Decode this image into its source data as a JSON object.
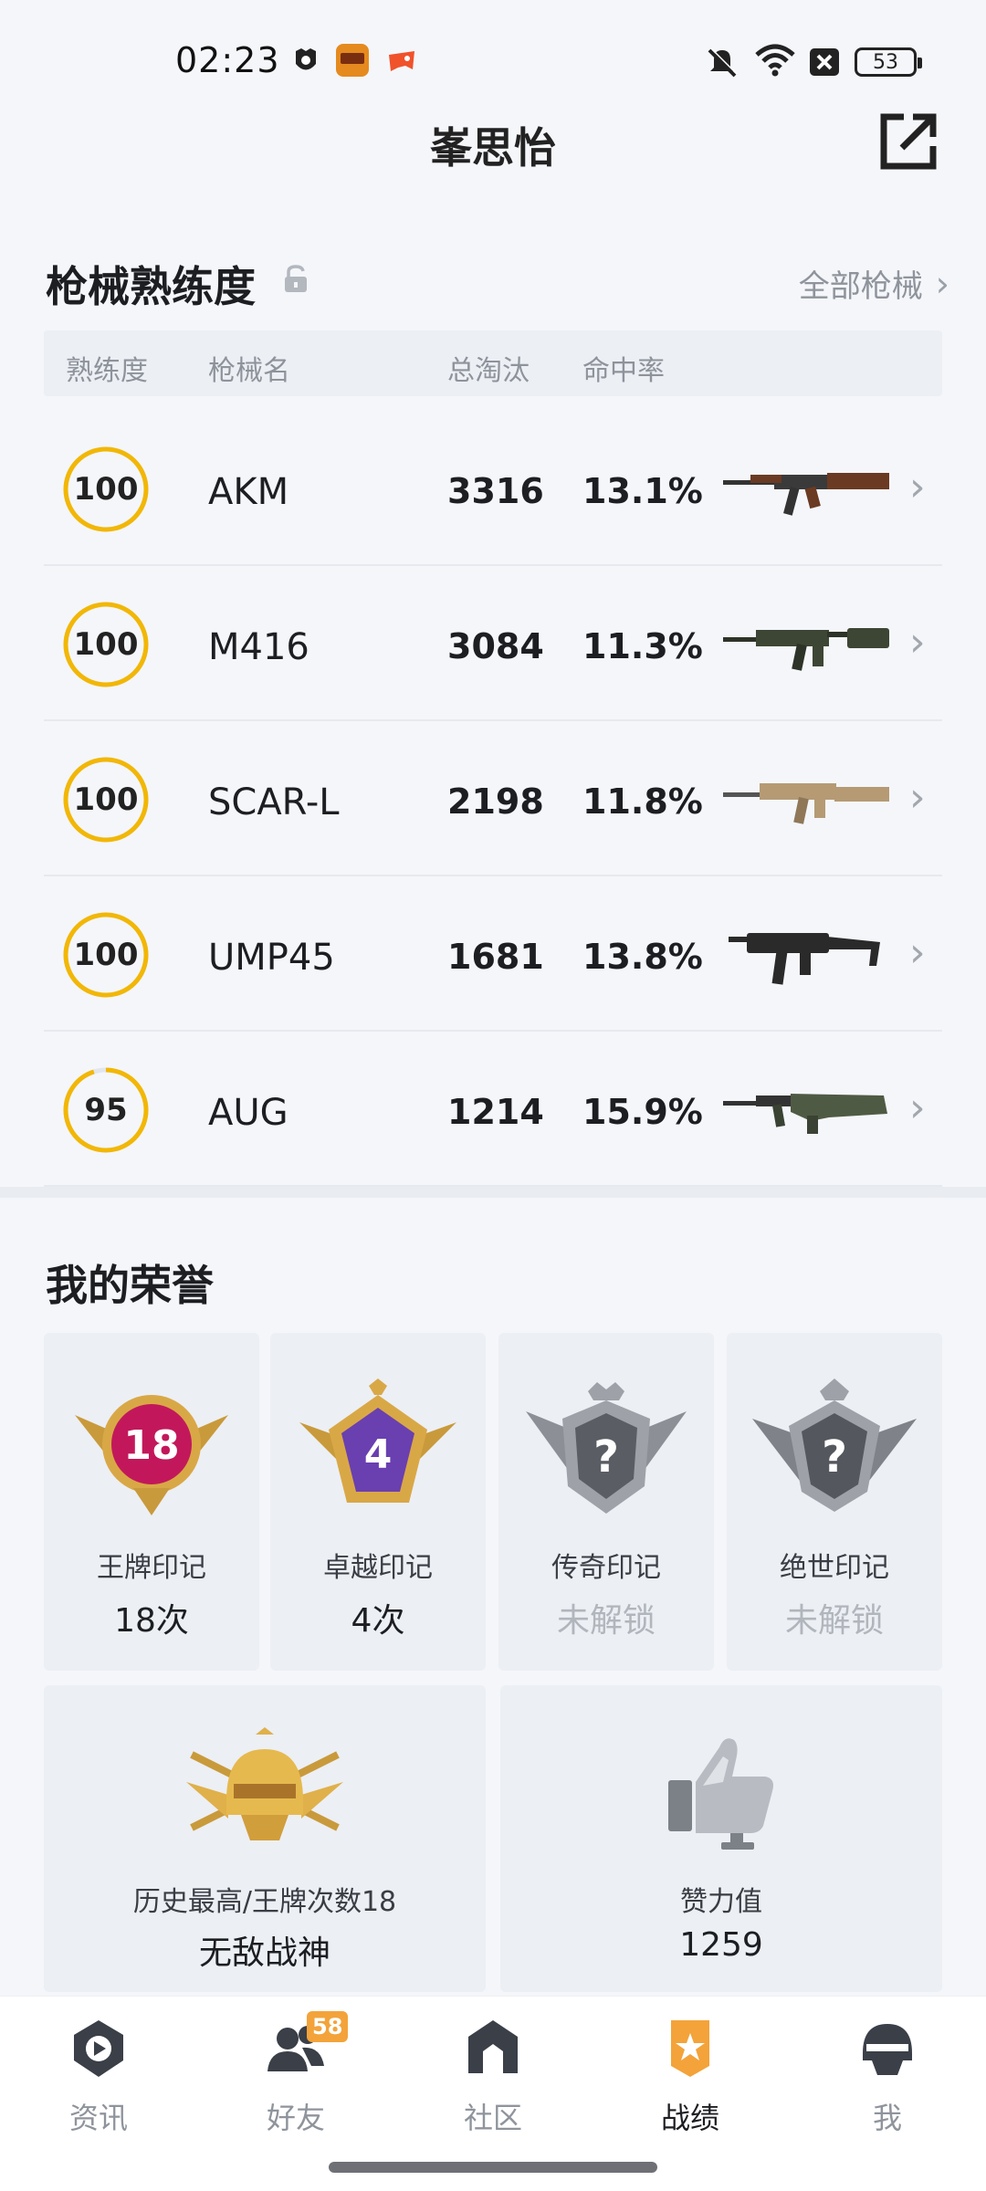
{
  "status_bar": {
    "time": "02:23",
    "battery": "53"
  },
  "header": {
    "title": "峯思怡"
  },
  "weapons": {
    "section_title": "枪械熟练度",
    "all_link": "全部枪械",
    "columns": {
      "proficiency": "熟练度",
      "name": "枪械名",
      "kills": "总淘汰",
      "accuracy": "命中率"
    },
    "rows": [
      {
        "proficiency": "100",
        "name": "AKM",
        "kills": "3316",
        "accuracy": "13.1%",
        "gun_color": "#6b3a22"
      },
      {
        "proficiency": "100",
        "name": "M416",
        "kills": "3084",
        "accuracy": "11.3%",
        "gun_color": "#3d4634"
      },
      {
        "proficiency": "100",
        "name": "SCAR-L",
        "kills": "2198",
        "accuracy": "11.8%",
        "gun_color": "#b59a74"
      },
      {
        "proficiency": "100",
        "name": "UMP45",
        "kills": "1681",
        "accuracy": "13.8%",
        "gun_color": "#2a2a2a"
      },
      {
        "proficiency": "95",
        "name": "AUG",
        "kills": "1214",
        "accuracy": "15.9%",
        "gun_color": "#4f5a44"
      }
    ]
  },
  "honors": {
    "section_title": "我的荣誉",
    "cards": [
      {
        "label": "王牌印记",
        "value": "18次",
        "emblem_text": "18",
        "locked": false
      },
      {
        "label": "卓越印记",
        "value": "4次",
        "emblem_text": "4",
        "locked": false
      },
      {
        "label": "传奇印记",
        "value": "未解锁",
        "emblem_text": "?",
        "locked": true
      },
      {
        "label": "绝世印记",
        "value": "未解锁",
        "emblem_text": "?",
        "locked": true
      }
    ],
    "big_cards": [
      {
        "label": "历史最高/王牌次数18",
        "value": "无敌战神"
      },
      {
        "label": "赞力值",
        "value": "1259"
      }
    ]
  },
  "nav": {
    "items": [
      {
        "label": "资讯",
        "icon": "news-icon"
      },
      {
        "label": "好友",
        "icon": "friends-icon",
        "badge": "58"
      },
      {
        "label": "社区",
        "icon": "community-icon"
      },
      {
        "label": "战绩",
        "icon": "record-icon",
        "active": true
      },
      {
        "label": "我",
        "icon": "me-icon"
      }
    ]
  },
  "colors": {
    "ring": "#f2b705",
    "accent_orange": "#f3a33a"
  }
}
